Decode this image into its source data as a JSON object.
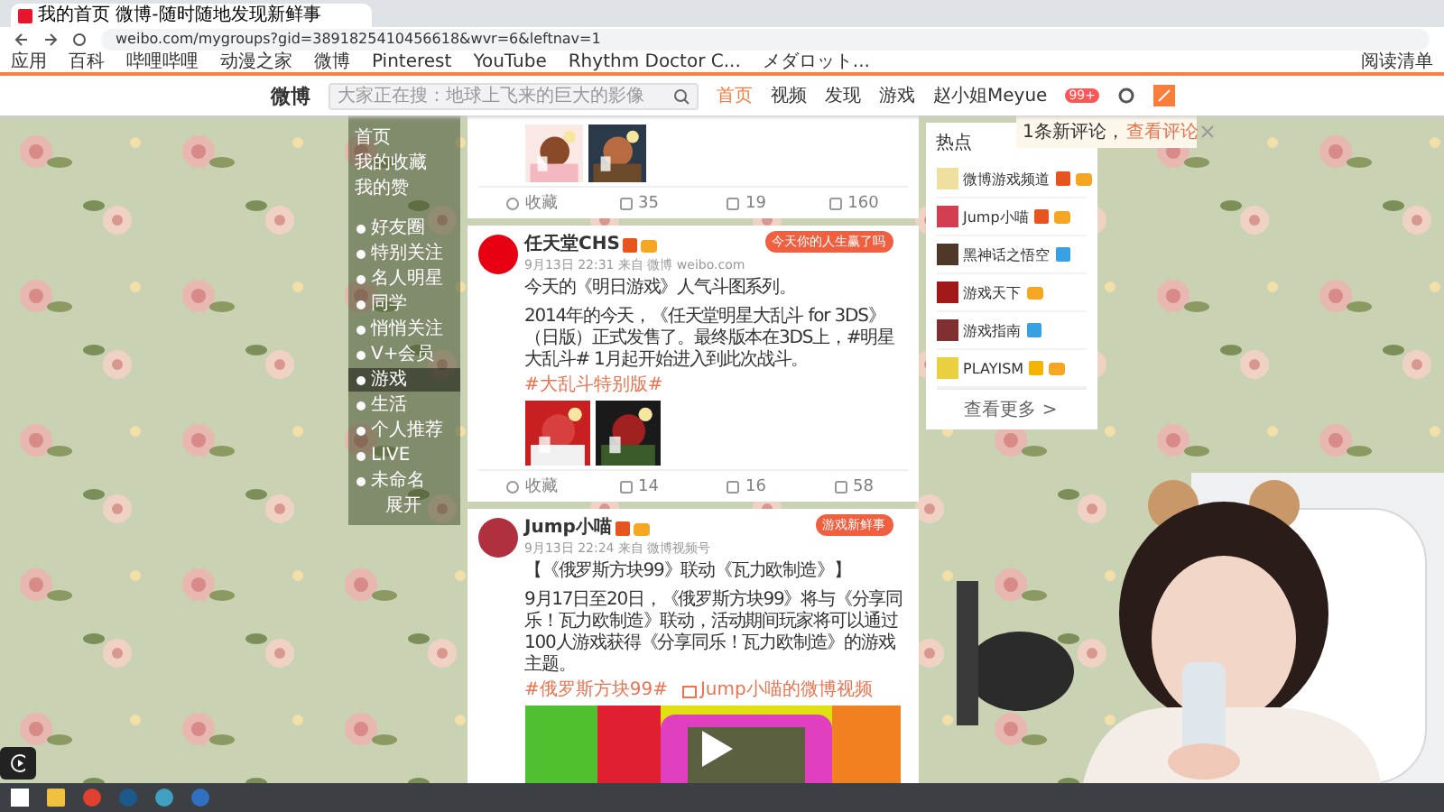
{
  "browser": {
    "tab_title": "我的首页 微博-随时随地发现新鲜事",
    "url": "weibo.com/mygroups?gid=3891825410456618&wvr=6&leftnav=1",
    "bookmarks": [
      "应用",
      "百科",
      "哔哩哔哩",
      "动漫之家",
      "微博",
      "Pinterest",
      "YouTube",
      "Rhythm Doctor C...",
      "メダロット..."
    ],
    "reading_list": "阅读清单"
  },
  "nav": {
    "logo": "微博",
    "search_placeholder": "大家正在搜：地球上飞来的巨大的影像",
    "user": "赵小姐Meyue",
    "items": [
      {
        "label": "首页",
        "selected": true
      },
      {
        "label": "视频",
        "selected": false
      },
      {
        "label": "发现",
        "selected": false
      },
      {
        "label": "游戏",
        "selected": false
      }
    ],
    "badge": "99+"
  },
  "sidebar": {
    "items": [
      {
        "label": "首页",
        "kind": "main",
        "selected": false
      },
      {
        "label": "我的收藏",
        "kind": "main",
        "selected": false
      },
      {
        "label": "我的赞",
        "kind": "main",
        "selected": false
      },
      {
        "label": "好友圈",
        "kind": "group",
        "selected": false
      },
      {
        "label": "特别关注",
        "kind": "group",
        "selected": false
      },
      {
        "label": "名人明星",
        "kind": "group",
        "selected": false
      },
      {
        "label": "同学",
        "kind": "group",
        "selected": false
      },
      {
        "label": "悄悄关注",
        "kind": "group",
        "selected": false
      },
      {
        "label": "V+会员",
        "kind": "group",
        "selected": false
      },
      {
        "label": "游戏",
        "kind": "group",
        "selected": true
      },
      {
        "label": "生活",
        "kind": "group",
        "selected": false
      },
      {
        "label": "个人推荐",
        "kind": "group",
        "selected": false
      },
      {
        "label": "LIVE",
        "kind": "group",
        "selected": false
      },
      {
        "label": "未命名",
        "kind": "group",
        "selected": false
      }
    ],
    "more": "展开"
  },
  "feed": [
    {
      "kind": "partial",
      "media": [
        {
          "kind": "picture"
        },
        {
          "kind": "picture"
        }
      ],
      "actions": [
        "收藏",
        "35",
        "19",
        "160"
      ]
    },
    {
      "kind": "post",
      "author": "任天堂CHS",
      "badges": [
        {
          "kind": "verified",
          "color": "#e8541e"
        },
        {
          "kind": "vip"
        }
      ],
      "card": "今天你的人生赢了吗",
      "meta": "9月13日 22:31 来自 微博 weibo.com",
      "paragraphs": [
        "今天的《明日游戏》人气斗图系列。",
        "2014年的今天，《任天堂明星大乱斗 for 3DS》（日版）正式发售了。最终版本在3DS上，#明星大乱斗# 1月起开始进入到此次战斗。"
      ],
      "tags": [
        "#大乱斗特别版#"
      ],
      "media": [
        {
          "kind": "picture"
        },
        {
          "kind": "picture"
        }
      ],
      "actions": [
        "收藏",
        "14",
        "16",
        "58"
      ]
    },
    {
      "kind": "post",
      "author": "Jump小喵",
      "badges": [
        {
          "kind": "verified",
          "color": "#e8541e"
        },
        {
          "kind": "vip"
        }
      ],
      "card": "游戏新鲜事",
      "meta": "9月13日 22:24 来自 微博视频号",
      "paragraphs": [
        "【《俄罗斯方块99》联动《瓦力欧制造》】",
        "9月17日至20日，《俄罗斯方块99》将与《分享同乐！瓦力欧制造》联动，活动期间玩家将可以通过100人游戏获得《分享同乐！瓦力欧制造》的游戏主题。"
      ],
      "tags": [
        "#俄罗斯方块99#",
        "Jump小喵的微博视频"
      ],
      "media": [
        {
          "kind": "video"
        }
      ]
    }
  ],
  "notice": {
    "text": "1条新评论，",
    "link": "查看评论"
  },
  "hot": {
    "title": "热点",
    "more": "查看更多 >",
    "users": [
      {
        "name": "微博游戏频道",
        "badges": [
          {
            "kind": "verified",
            "color": "#e8541e"
          },
          {
            "kind": "vip"
          }
        ]
      },
      {
        "name": "Jump小喵",
        "badges": [
          {
            "kind": "verified",
            "color": "#e8541e"
          },
          {
            "kind": "vip"
          }
        ]
      },
      {
        "name": "黑神话之悟空",
        "badges": [
          {
            "kind": "verified",
            "color": "#3aa0e4"
          }
        ]
      },
      {
        "name": "游戏天下",
        "badges": [
          {
            "kind": "vip"
          }
        ]
      },
      {
        "name": "游戏指南",
        "badges": [
          {
            "kind": "verified",
            "color": "#3aa0e4"
          }
        ]
      },
      {
        "name": "PLAYISM",
        "badges": [
          {
            "kind": "verified",
            "color": "#f5b400"
          },
          {
            "kind": "vip"
          }
        ]
      }
    ]
  }
}
